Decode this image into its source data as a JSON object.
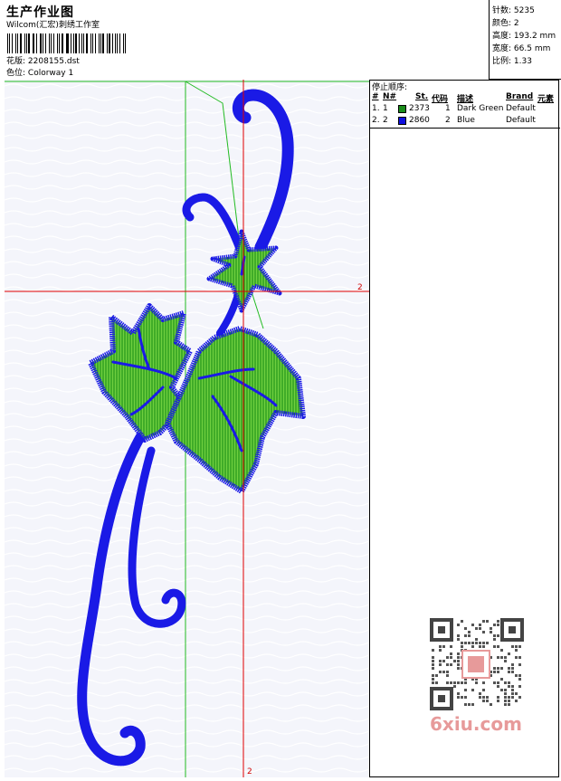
{
  "header": {
    "title": "生产作业图",
    "company": "Wilcom(汇宏)刺绣工作室",
    "design_label": "花版:",
    "design_value": "2208155.dst",
    "colorway_label": "色位:",
    "colorway_value": "Colorway 1"
  },
  "stats": [
    {
      "label": "针数:",
      "value": "5235"
    },
    {
      "label": "颜色:",
      "value": "2"
    },
    {
      "label": "高度:",
      "value": "193.2 mm"
    },
    {
      "label": "宽度:",
      "value": "66.5 mm"
    },
    {
      "label": "比例:",
      "value": "1.33"
    }
  ],
  "stop_sequence": {
    "heading": "停止顺序:",
    "columns": [
      "#",
      "N#",
      "St.",
      "代码",
      "描述",
      "Brand",
      "元素"
    ],
    "rows": [
      {
        "index": "1.",
        "n": "1",
        "stitches": "2373",
        "code": "1",
        "description": "Dark Green",
        "brand": "Default",
        "color": "#1a8c1a"
      },
      {
        "index": "2.",
        "n": "2",
        "stitches": "2860",
        "code": "2",
        "description": "Blue",
        "brand": "Default",
        "color": "#1010e0"
      }
    ]
  },
  "crosshair": {
    "h_label": "2",
    "v_label": "2",
    "color": "#e00000"
  },
  "guide_color": "#22bb22",
  "design_colors": {
    "fill": "#22aa22",
    "outline": "#1a1ae6"
  },
  "watermark": "6xiu.com"
}
